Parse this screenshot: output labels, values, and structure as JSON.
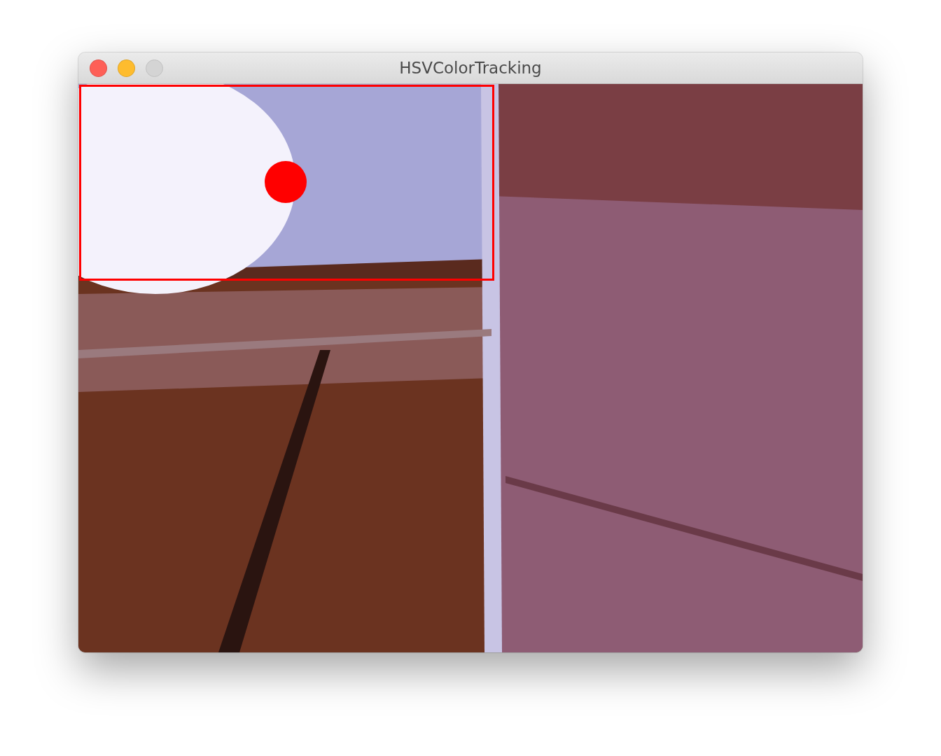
{
  "window": {
    "title": "HSVColorTracking"
  },
  "traffic_lights": [
    {
      "kind": "close",
      "disabled": false
    },
    {
      "kind": "minimize",
      "disabled": false
    },
    {
      "kind": "zoom",
      "disabled": true
    }
  ],
  "tracking": {
    "detected": true
  }
}
